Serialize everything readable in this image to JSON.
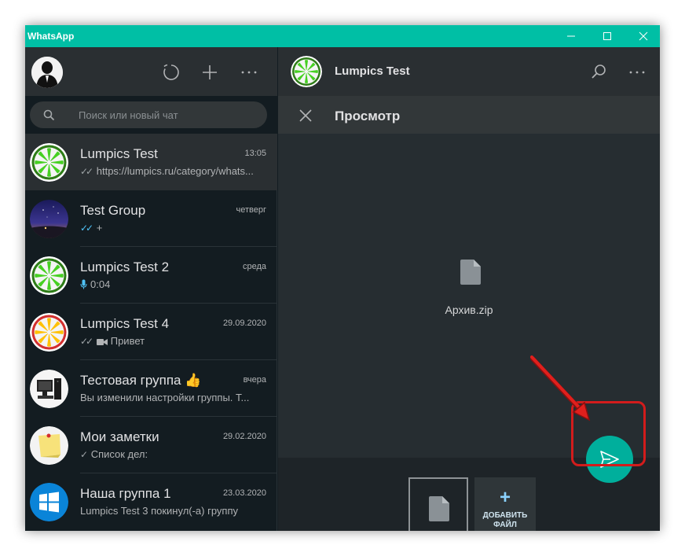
{
  "window": {
    "title": "WhatsApp"
  },
  "sidebar": {
    "search_placeholder": "Поиск или новый чат",
    "chats": [
      {
        "name": "Lumpics Test",
        "time": "13:05",
        "preview": "https://lumpics.ru/category/whats...",
        "tick": "✓✓",
        "active": true,
        "avatar": "lime-icon"
      },
      {
        "name": "Test Group",
        "time": "четверг",
        "preview": "+",
        "tick": "✓✓",
        "tick_blue": true,
        "avatar": "night-sky-avatar"
      },
      {
        "name": "Lumpics Test 2",
        "time": "среда",
        "preview": "0:04",
        "avatar": "lime-icon",
        "mic": true
      },
      {
        "name": "Lumpics Test 4",
        "time": "29.09.2020",
        "preview": "Привет",
        "tick": "✓✓",
        "avatar": "orange-slice-icon",
        "video": true
      },
      {
        "name": "Тестовая группа 👍",
        "time": "вчера",
        "preview": "Вы изменили настройки группы. Т...",
        "avatar": "computer-avatar"
      },
      {
        "name": "Мои заметки",
        "time": "29.02.2020",
        "preview": "Список дел:",
        "tick": "✓",
        "avatar": "sticky-note-avatar"
      },
      {
        "name": "Наша группа 1",
        "time": "23.03.2020",
        "preview": "Lumpics Test 3 покинул(-а) группу",
        "avatar": "windows-logo-avatar"
      }
    ]
  },
  "main": {
    "chat_title": "Lumpics Test",
    "preview_title": "Просмотр",
    "file_name": "Архив.zip",
    "add_file_label": "ДОБАВИТЬ ФАЙЛ"
  },
  "colors": {
    "titlebar": "#00bfa5",
    "send_button": "#00af9c",
    "highlight": "#d21c1c"
  }
}
